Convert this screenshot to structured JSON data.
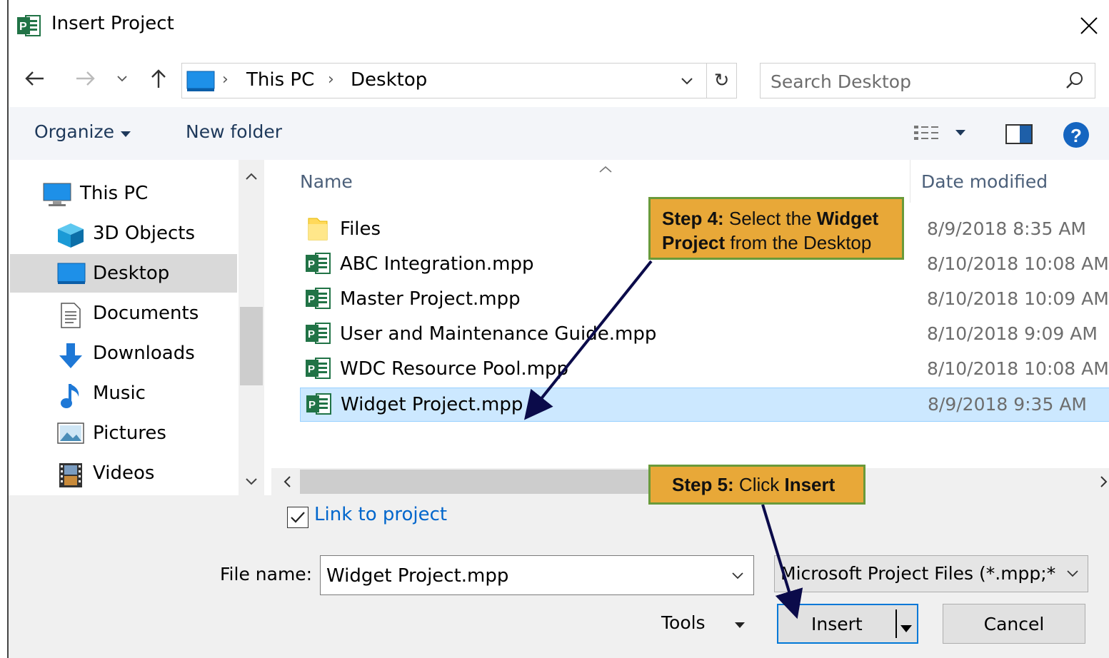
{
  "window": {
    "title": "Insert Project",
    "app_icon": "project-icon",
    "close_icon": "close-icon"
  },
  "nav": {
    "back_icon": "arrow-left-icon",
    "forward_icon": "arrow-right-icon",
    "recent_icon": "chevron-down-icon",
    "up_icon": "arrow-up-icon",
    "breadcrumb": [
      "This PC",
      "Desktop"
    ],
    "refresh_icon": "refresh-icon"
  },
  "search": {
    "placeholder": "Search Desktop",
    "icon": "search-icon"
  },
  "toolbar": {
    "organize_label": "Organize",
    "new_folder_label": "New folder",
    "view_icon": "view-options-icon",
    "preview_icon": "preview-pane-icon",
    "help_icon": "help-icon"
  },
  "sidebar": {
    "items": [
      {
        "label": "This PC",
        "icon": "computer-icon"
      },
      {
        "label": "3D Objects",
        "icon": "cube-icon"
      },
      {
        "label": "Desktop",
        "icon": "desktop-icon",
        "selected": true
      },
      {
        "label": "Documents",
        "icon": "document-icon"
      },
      {
        "label": "Downloads",
        "icon": "download-icon"
      },
      {
        "label": "Music",
        "icon": "music-note-icon"
      },
      {
        "label": "Pictures",
        "icon": "picture-icon"
      },
      {
        "label": "Videos",
        "icon": "film-icon"
      }
    ]
  },
  "filelist": {
    "columns": {
      "name": "Name",
      "date": "Date modified"
    },
    "rows": [
      {
        "name": "Files",
        "date": "8/9/2018 8:35 AM",
        "icon": "folder-icon"
      },
      {
        "name": "ABC Integration.mpp",
        "date": "8/10/2018 10:08 AM",
        "icon": "project-file-icon"
      },
      {
        "name": "Master Project.mpp",
        "date": "8/10/2018 10:09 AM",
        "icon": "project-file-icon"
      },
      {
        "name": "User and Maintenance Guide.mpp",
        "date": "8/10/2018 9:09 AM",
        "icon": "project-file-icon"
      },
      {
        "name": "WDC Resource Pool.mpp",
        "date": "8/10/2018 10:08 AM",
        "icon": "project-file-icon"
      },
      {
        "name": "Widget Project.mpp",
        "date": "8/9/2018 9:35 AM",
        "icon": "project-file-icon",
        "selected": true
      }
    ]
  },
  "bottom": {
    "link_to_project_label": "Link to project",
    "link_to_project_checked": true,
    "file_name_label": "File name:",
    "file_name_value": "Widget Project.mpp",
    "file_type_value": "Microsoft Project Files (*.mpp;*",
    "tools_label": "Tools",
    "insert_label": "Insert",
    "cancel_label": "Cancel"
  },
  "callouts": {
    "step4": {
      "prefix": "Step 4:",
      "text1": " Select the ",
      "bold1": "Widget",
      "bold2": "Project",
      "text2": " from the Desktop"
    },
    "step5": {
      "prefix": "Step 5:",
      "text1": " Click ",
      "bold1": "Insert"
    }
  },
  "colors": {
    "accent": "#0078d7",
    "selection": "#cce8ff",
    "callout_fill": "#e8a838",
    "callout_border": "#6a9a3a",
    "arrow": "#0b0b4a"
  }
}
